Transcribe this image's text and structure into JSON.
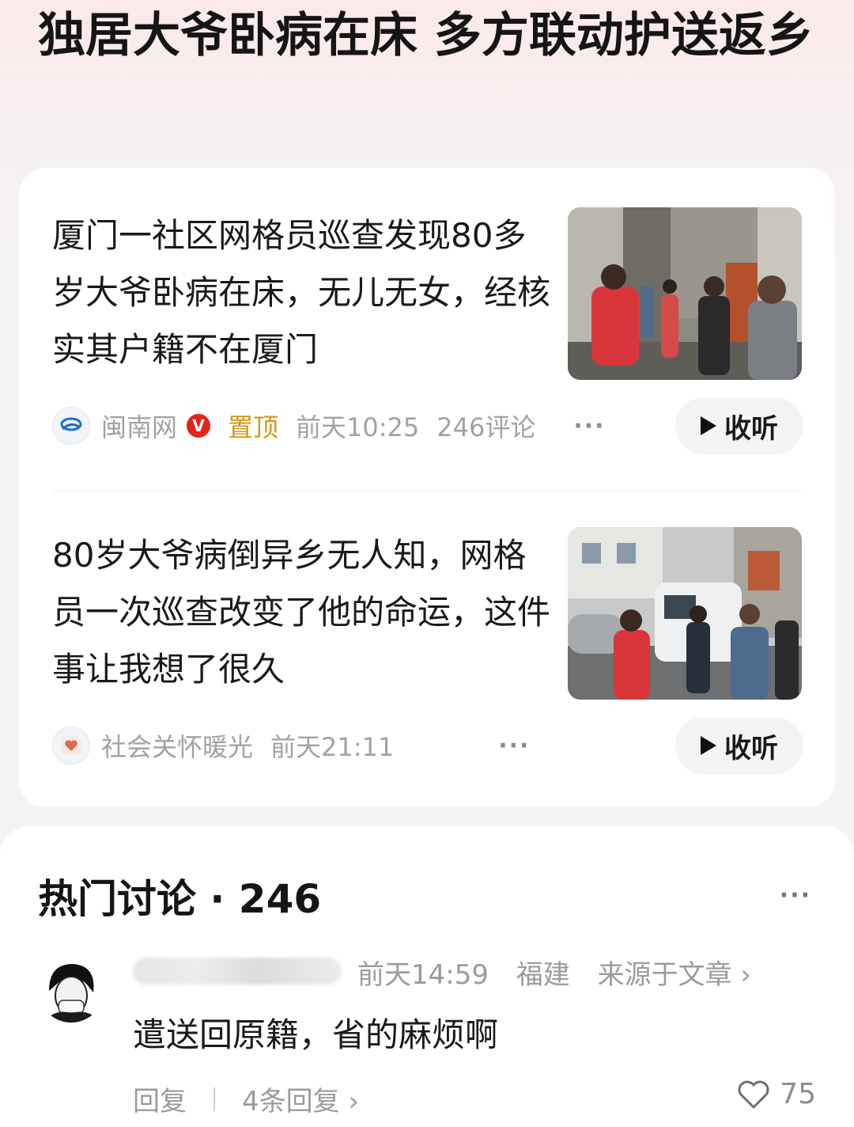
{
  "topic": {
    "title": "独居大爷卧病在床 多方联动护送返乡"
  },
  "articles": [
    {
      "title": "厦门一社区网格员巡查发现80多岁大爷卧病在床，无儿无女，经核实其户籍不在厦门",
      "source": "闽南网",
      "verified_badge": "V",
      "pinned": "置顶",
      "time": "前天10:25",
      "comments": "246评论",
      "more": "···",
      "listen": "收听"
    },
    {
      "title": "80岁大爷病倒异乡无人知，网格员一次巡查改变了他的命运，这件事让我想了很久",
      "source": "社会关怀暖光",
      "time": "前天21:11",
      "more": "···",
      "listen": "收听"
    }
  ],
  "discussion": {
    "title": "热门讨论 · 246",
    "more": "···",
    "comment": {
      "time": "前天14:59",
      "location": "福建",
      "source": "来源于文章 ›",
      "text": "遣送回原籍，省的麻烦啊",
      "reply": "回复",
      "replies": "4条回复 ›",
      "likes": "75"
    }
  },
  "colors": {
    "pinned": "#d89512",
    "verified": "#e1251b",
    "vest": "#d8363a"
  }
}
